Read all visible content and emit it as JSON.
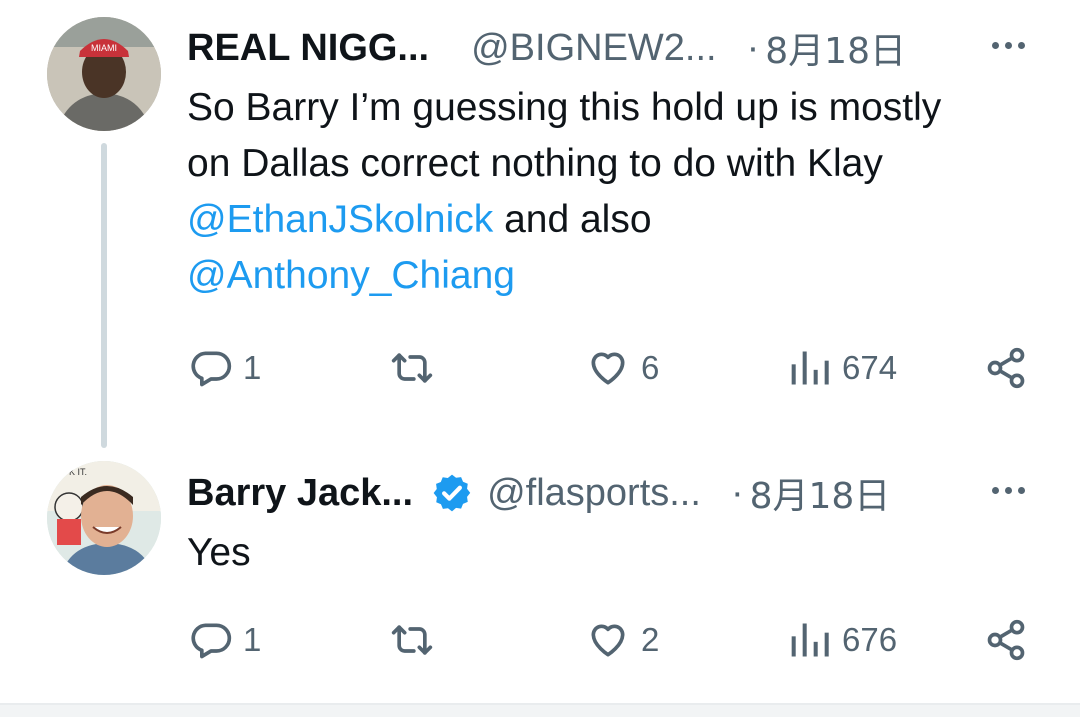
{
  "tweets": [
    {
      "author_name": "REAL NIGG...",
      "handle": "@BIGNEW2...",
      "separator": "·",
      "date": "8月18日",
      "verified": false,
      "text_line1": "So Barry I’m guessing this hold up is mostly",
      "text_line2": "on Dallas correct nothing to do with Klay",
      "mention1": "@EthanJSkolnick",
      "text_after_mention": " and also",
      "mention2": "@Anthony_Chiang",
      "replies": "1",
      "likes": "6",
      "views": "674"
    },
    {
      "author_name": "Barry Jack...",
      "handle": "@flasports...",
      "separator": "·",
      "date": "8月18日",
      "verified": true,
      "text": "Yes",
      "replies": "1",
      "likes": "2",
      "views": "676"
    }
  ],
  "icons": {
    "reply": "speech-bubble-icon",
    "retweet": "retweet-arrows-icon",
    "like": "heart-icon",
    "views": "bar-chart-icon",
    "share": "share-nodes-icon",
    "more": "ellipsis-icon",
    "verified": "verified-badge-icon"
  },
  "colors": {
    "mention": "#1d9bf0",
    "muted": "#536471",
    "verified_badge": "#1d9bf0",
    "thread_line": "#cfd9de"
  }
}
